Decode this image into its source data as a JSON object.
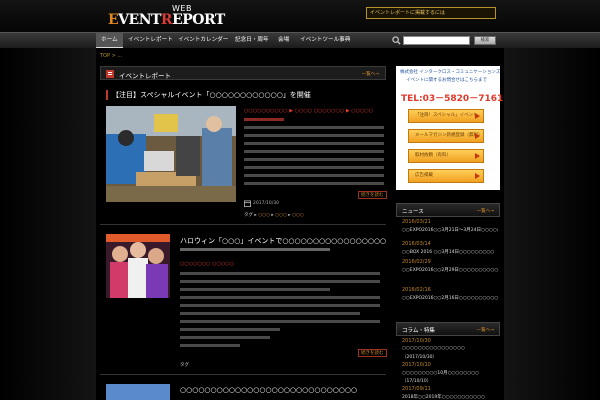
{
  "header": {
    "logo_web": "WEB",
    "logo_brand_e": "E",
    "logo_brand_vent": "VENT",
    "logo_brand_r": "R",
    "logo_brand_eport": "EPORT",
    "top_link": "イベントレポートに掲載するには"
  },
  "nav": {
    "items": [
      "ホーム",
      "イベントレポート",
      "イベントカレンダー",
      "記念日・周年",
      "会場",
      "イベントツール事典"
    ],
    "search_button": "検索"
  },
  "breadcrumb": "TOP > ...",
  "section": {
    "title": "イベントレポート",
    "more": "一覧へ→"
  },
  "articles": [
    {
      "title": "【注目】スペシャルイベント「○○○○○○○○○○○○」を開催",
      "tagline": "○○○○○○○○○○ ▶ ○○○○ ○○○○○○○ ▶ ○○○○○",
      "date": "2017/10/30",
      "more": "続きを読む",
      "tags": [
        "タグ",
        "○○○",
        "○○○",
        "○○○"
      ]
    },
    {
      "title": "ハロウィン「○○○」イベントで○○○○○○○○○○○○○○○○○○○○○○○○○○○○○○",
      "tagline": "○○○○○○○  ○○○○○",
      "more": "続きを読む",
      "tags": [
        "タグ"
      ]
    },
    {
      "title": "○○○○○○○○○○○○○○○○○○○○○○○○○○○○○"
    }
  ],
  "sidebar": {
    "ad_company": "株式会社 インタークロス・コミュニケーションズ",
    "ad_sub": "イベントに関するお問合せはこちらまで",
    "ad_tel": "TEL:03－5820－7161",
    "buttons": [
      "「注目！スペシャル」イベント",
      "メールマガジン新規登録（無料）",
      "取材依頼（有料）",
      "広告掲載"
    ],
    "news_title": "ニュース",
    "news_more": "一覧へ→",
    "news": [
      {
        "date": "2016/03/21",
        "text": "○○EXPO2016○○3月21日～3月24日○○○○○"
      },
      {
        "date": "2016/03/14",
        "text": "○○BOX 2016 ○○3月14日○○○○○○○○○"
      },
      {
        "date": "2016/02/29",
        "text": "○○EXPO2016○○2月29日○○○○○○○○○○"
      },
      {
        "date": "2016/02/16",
        "text": "○○EXPO2016○○2月16日○○○○○○○○○○"
      }
    ],
    "column_title": "コラム・特集",
    "column_more": "一覧へ→",
    "columns": [
      {
        "date": "2017/10/30",
        "text": "○○○○○○○○○○○○○○○○",
        "text2": "（2017/10/30）"
      },
      {
        "date": "2017/10/10",
        "text": "○○○○○○○○○10月○○○○○○○○",
        "text2": "（17/10/10）"
      },
      {
        "date": "2017/09/11",
        "text": "2018年○○2019年○○○○○○○○○○○"
      }
    ]
  },
  "colors": {
    "accent": "#d68f2a",
    "red": "#e0392b",
    "bg": "#000000"
  }
}
